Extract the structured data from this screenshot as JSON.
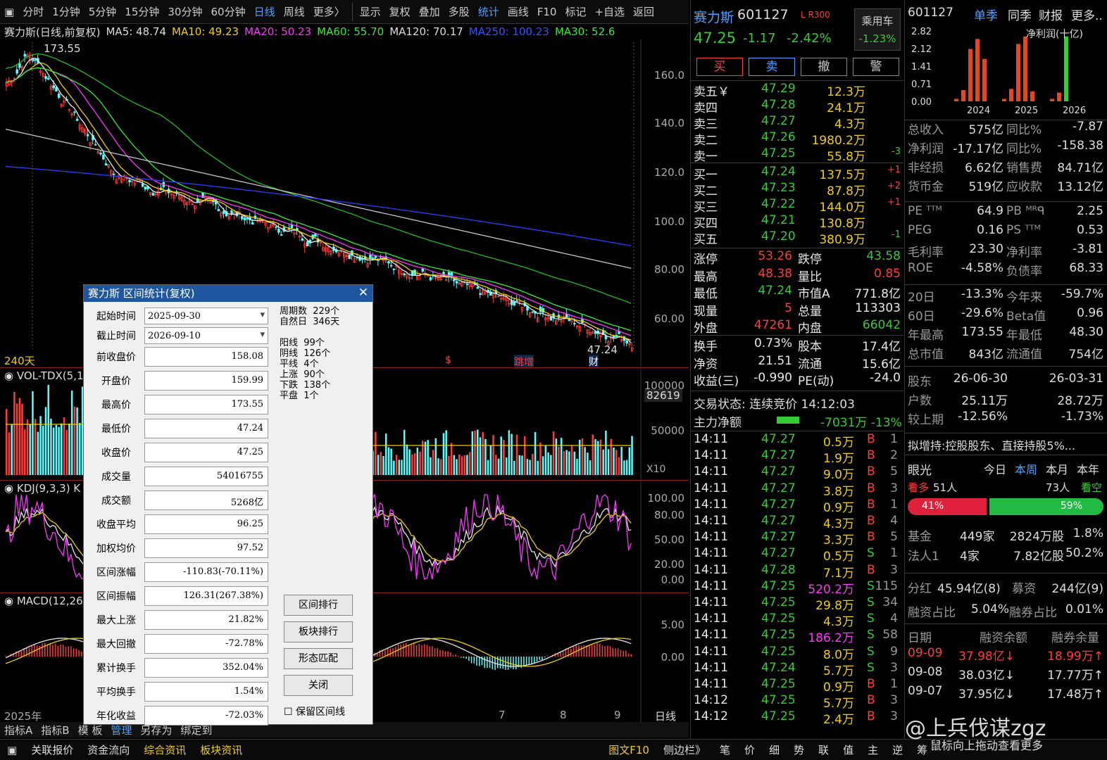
{
  "toolbar": {
    "left_items": [
      "分时",
      "1分钟",
      "5分钟",
      "15分钟",
      "30分钟",
      "60分钟",
      "日线",
      "周线",
      "更多〉"
    ],
    "right_items": [
      "显示",
      "复权",
      "叠加",
      "多股",
      "统计",
      "画线",
      "F10",
      "标记",
      "+自选",
      "返回"
    ],
    "active_left": "日线",
    "active_right": "统计"
  },
  "infobar": {
    "title": "赛力斯(日线,前复权)",
    "ma5": "MA5: 48.74",
    "ma10": "MA10: 49.23",
    "ma20": "MA20: 50.23",
    "ma60": "MA60: 55.70",
    "ma120": "MA120: 70.17",
    "ma250": "MA250: 100.23",
    "ma30": "MA30: 52.6"
  },
  "mainchart": {
    "high_label": "173.55",
    "low_label": "47.24",
    "days_label": "240天",
    "yticks": [
      "160.0",
      "140.0",
      "120.0",
      "100.0",
      "80.00",
      "60.00"
    ],
    "markers": [
      "$",
      "$",
      "跳增",
      "财"
    ]
  },
  "vol": {
    "label": "VOL-TDX(5,1",
    "value": "82619",
    "yticks": [
      "100000",
      "50000"
    ],
    "unit": "X10"
  },
  "kdj": {
    "label": "KDJ(9,3,3) K",
    "yticks": [
      "100.00",
      "80.00",
      "50.00",
      "20.00",
      "0.00"
    ]
  },
  "macd": {
    "label": "MACD(12,26",
    "yticks": [
      "5.00",
      "0.00"
    ],
    "year": "2025年",
    "x_ticks": [
      "7",
      "8",
      "9"
    ],
    "period": "日线"
  },
  "bottomtabs": [
    "指标A",
    "指标B",
    "模 板",
    "管理",
    "另存为",
    "绑定到"
  ],
  "statusbar": [
    "关联报价",
    "资金流向",
    "综合资讯",
    "板块资讯",
    "图文F10",
    "侧边栏》",
    "笔",
    "价",
    "细",
    "势",
    "联",
    "值",
    "主",
    "逆",
    "筹"
  ],
  "dialog": {
    "title": "赛力斯 区间统计(复权)",
    "start_label": "起始时间",
    "start": "2025-09-30",
    "end_label": "截止时间",
    "end": "2026-09-10",
    "rows": [
      {
        "label": "前收盘价",
        "value": "158.08"
      },
      {
        "label": "开盘价",
        "value": "159.99"
      },
      {
        "label": "最高价",
        "value": "173.55"
      },
      {
        "label": "最低价",
        "value": "47.24"
      },
      {
        "label": "收盘价",
        "value": "47.25"
      },
      {
        "label": "成交量",
        "value": "54016755"
      },
      {
        "label": "成交额",
        "value": "5268亿"
      },
      {
        "label": "收盘平均",
        "value": "96.25"
      },
      {
        "label": "加权均价",
        "value": "97.52"
      },
      {
        "label": "区间涨幅",
        "value": "-110.83(-70.11%)"
      },
      {
        "label": "区间振幅",
        "value": "126.31(267.38%)"
      },
      {
        "label": "最大上涨",
        "value": "21.82%"
      },
      {
        "label": "最大回撤",
        "value": "-72.78%"
      },
      {
        "label": "累计换手",
        "value": "352.04%"
      },
      {
        "label": "平均换手",
        "value": "1.54%"
      },
      {
        "label": "年化收益",
        "value": "-72.03%"
      }
    ],
    "stats": [
      "周期数  229个",
      "自然日  346天",
      "",
      "阳线  99个",
      "阴线  126个",
      "平线  4个",
      "上涨  90个",
      "下跌  138个",
      "平盘  1个"
    ],
    "buttons": [
      "区间排行",
      "板块排行",
      "形态匹配",
      "关闭"
    ],
    "checkbox": "保留区间线"
  },
  "quote": {
    "name": "赛力斯",
    "code": "601127",
    "tag": "L R300",
    "sector": "乘用车",
    "price": "47.25",
    "change": "-1.17",
    "pct": "-2.42%",
    "sector_pct": "-1.23%",
    "buttons": [
      "买",
      "卖",
      "撤",
      "警"
    ],
    "sells": [
      {
        "label": "卖五￥",
        "price": "47.29",
        "vol": "12.3万",
        "chg": ""
      },
      {
        "label": "卖四",
        "price": "47.28",
        "vol": "24.1万",
        "chg": ""
      },
      {
        "label": "卖三",
        "price": "47.27",
        "vol": "4.3万",
        "chg": ""
      },
      {
        "label": "卖二",
        "price": "47.26",
        "vol": "1980.2万",
        "chg": ""
      },
      {
        "label": "卖一",
        "price": "47.25",
        "vol": "55.8万",
        "chg": "-3"
      }
    ],
    "buys": [
      {
        "label": "买一",
        "price": "47.24",
        "vol": "137.5万",
        "chg": "+1"
      },
      {
        "label": "买二",
        "price": "47.23",
        "vol": "87.8万",
        "chg": "+2"
      },
      {
        "label": "买三",
        "price": "47.22",
        "vol": "144.0万",
        "chg": "+1"
      },
      {
        "label": "买四",
        "price": "47.21",
        "vol": "130.8万",
        "chg": ""
      },
      {
        "label": "买五",
        "price": "47.20",
        "vol": "380.9万",
        "chg": "-1"
      }
    ],
    "stats": [
      {
        "l1": "涨停",
        "v1": "53.26",
        "l2": "跌停",
        "v2": "43.58"
      },
      {
        "l1": "最高",
        "v1": "48.38",
        "l2": "量比",
        "v2": "0.85"
      },
      {
        "l1": "最低",
        "v1": "47.24",
        "l2": "市值A",
        "v2": "771.8亿"
      },
      {
        "l1": "现量",
        "v1": "5",
        "l2": "总量",
        "v2": "113303"
      },
      {
        "l1": "外盘",
        "v1": "47261",
        "l2": "内盘",
        "v2": "66042"
      },
      {
        "l1": "换手",
        "v1": "0.73%",
        "l2": "股本",
        "v2": "17.4亿"
      },
      {
        "l1": "净资",
        "v1": "21.51",
        "l2": "流通",
        "v2": "15.6亿"
      },
      {
        "l1": "收益(三)",
        "v1": "-0.990",
        "l2": "PE(动)",
        "v2": "-24.0"
      }
    ],
    "status": "交易状态: 连续竞价 14:12:03",
    "flow_label": "主力净额",
    "flow_value": "-7031万 -13%",
    "ticks": [
      {
        "t": "14:11",
        "p": "47.27",
        "v": "0.5万",
        "s": "B",
        "n": "1"
      },
      {
        "t": "14:11",
        "p": "47.27",
        "v": "1.9万",
        "s": "B",
        "n": "2"
      },
      {
        "t": "14:11",
        "p": "47.27",
        "v": "9.0万",
        "s": "B",
        "n": "5"
      },
      {
        "t": "14:11",
        "p": "47.27",
        "v": "3.8万",
        "s": "B",
        "n": "3"
      },
      {
        "t": "14:11",
        "p": "47.27",
        "v": "0.9万",
        "s": "B",
        "n": "1"
      },
      {
        "t": "14:11",
        "p": "47.27",
        "v": "4.3万",
        "s": "B",
        "n": "4"
      },
      {
        "t": "14:11",
        "p": "47.27",
        "v": "3.3万",
        "s": "B",
        "n": "5"
      },
      {
        "t": "14:11",
        "p": "47.27",
        "v": "0.5万",
        "s": "S",
        "n": "1"
      },
      {
        "t": "14:11",
        "p": "47.28",
        "v": "7.1万",
        "s": "B",
        "n": "3"
      },
      {
        "t": "14:11",
        "p": "47.25",
        "v": "520.2万",
        "s": "S",
        "n": "115"
      },
      {
        "t": "14:11",
        "p": "47.25",
        "v": "29.8万",
        "s": "S",
        "n": "34"
      },
      {
        "t": "14:11",
        "p": "47.25",
        "v": "4.3万",
        "s": "S",
        "n": "4"
      },
      {
        "t": "14:11",
        "p": "47.25",
        "v": "186.2万",
        "s": "S",
        "n": "58"
      },
      {
        "t": "14:11",
        "p": "47.25",
        "v": "8.0万",
        "s": "S",
        "n": "9"
      },
      {
        "t": "14:11",
        "p": "47.24",
        "v": "5.7万",
        "s": "S",
        "n": "3"
      },
      {
        "t": "14:11",
        "p": "47.25",
        "v": "0.9万",
        "s": "B",
        "n": "1"
      },
      {
        "t": "14:12",
        "p": "47.25",
        "v": "5.7万",
        "s": "B",
        "n": "3"
      },
      {
        "t": "14:12",
        "p": "47.25",
        "v": "2.4万",
        "s": "B",
        "n": "3"
      }
    ]
  },
  "fin": {
    "code": "601127",
    "tabs": [
      "单季",
      "同季",
      "财报",
      "更多.."
    ],
    "chart_title": "净利润(十亿)",
    "chart_data": {
      "type": "bar",
      "title": "净利润(十亿)",
      "categories": [
        "2024",
        "2025",
        "2026"
      ],
      "yticks": [
        "2.82",
        "2.12",
        "1.41",
        "0.71",
        "0.00"
      ],
      "ylim": [
        0,
        2.82
      ],
      "bars": [
        {
          "year": "2024",
          "values": [
            0.1,
            0.45,
            2.1,
            2.5,
            1.7
          ]
        },
        {
          "year": "2025",
          "values": [
            0.1,
            0.5,
            2.3,
            2.6,
            0.4
          ]
        },
        {
          "year": "2026",
          "values": [
            0.1,
            0.35,
            2.6
          ]
        }
      ],
      "colors": {
        "normal": "#e8461c",
        "latest": "#2fd12f"
      }
    },
    "rows": [
      {
        "l1": "总收入",
        "v1": "575亿",
        "l2": "同比%",
        "v2": "-7.87"
      },
      {
        "l1": "净利润",
        "v1": "-17.17亿",
        "l2": "同比%",
        "v2": "-158.38"
      },
      {
        "l1": "非经损",
        "v1": "6.62亿",
        "l2": "销售费",
        "v2": "84.71亿"
      },
      {
        "l1": "货币金",
        "v1": "519亿",
        "l2": "应收款",
        "v2": "13.12亿"
      },
      {
        "l1": "PE ᵀᵀᴹ",
        "v1": "64.9",
        "l2": "PB ᴹᴿᑫ",
        "v2": "2.25"
      },
      {
        "l1": "PEG",
        "v1": "0.16",
        "l2": "PS ᵀᵀᴹ",
        "v2": "0.53"
      },
      {
        "l1": "毛利率",
        "v1": "23.30",
        "l2": "净利率",
        "v2": "-3.81"
      },
      {
        "l1": "ROE",
        "v1": "-4.58%",
        "l2": "负债率",
        "v2": "68.33"
      },
      {
        "l1": "20日",
        "v1": "-13.3%",
        "l2": "今年来",
        "v2": "-59.7%"
      },
      {
        "l1": "60日",
        "v1": "-29.6%",
        "l2": "Beta值",
        "v2": "0.96"
      },
      {
        "l1": "年最高",
        "v1": "173.55",
        "l2": "年最低",
        "v2": "48.30"
      },
      {
        "l1": "总市值",
        "v1": "843亿",
        "l2": "流通值",
        "v2": "754亿"
      }
    ],
    "holders": [
      {
        "a": "股东",
        "b": "26-06-30",
        "c": "26-03-31"
      },
      {
        "a": "户数",
        "b": "25.11万",
        "c": "28.72万"
      },
      {
        "a": "较上期",
        "b": "-12.56%",
        "c": "-1.73%"
      }
    ],
    "notice": "拟增持:控股股东、直接持股5%...",
    "yanguang": "眼光",
    "periods": [
      "今日",
      "本周",
      "本月",
      "本年"
    ],
    "bull": "看多",
    "bull_n": "51人",
    "bear_n": "73人",
    "bear": "看空",
    "bull_pct": "41%",
    "bear_pct": "59%",
    "bull_ratio": 0.41,
    "funds": [
      {
        "a": "基金",
        "b": "449家",
        "c": "2824万股",
        "d": "1.8%"
      },
      {
        "a": "法人1",
        "b": "4家",
        "c": "7.82亿股",
        "d": "50.2%"
      }
    ],
    "dividend": {
      "a": "分红",
      "b": "45.94亿(8)",
      "c": "募资",
      "d": "244亿(9)"
    },
    "margin": {
      "a": "融资占比",
      "b": "5.04%",
      "c": "融券占比",
      "d": "0.01%"
    },
    "margin_head": [
      "日期",
      "融资余额",
      "融券余量"
    ],
    "margin_rows": [
      {
        "d": "09-09",
        "a": "37.98亿↓",
        "b": "18.99万↑"
      },
      {
        "d": "09-08",
        "a": "38.03亿↓",
        "b": "17.77万↑"
      },
      {
        "d": "09-07",
        "a": "37.95亿↓",
        "b": "17.48万↑"
      }
    ],
    "watermark": "@上兵伐谋zgz",
    "scroll_hint": "鼠标向上拖动查看更多"
  }
}
